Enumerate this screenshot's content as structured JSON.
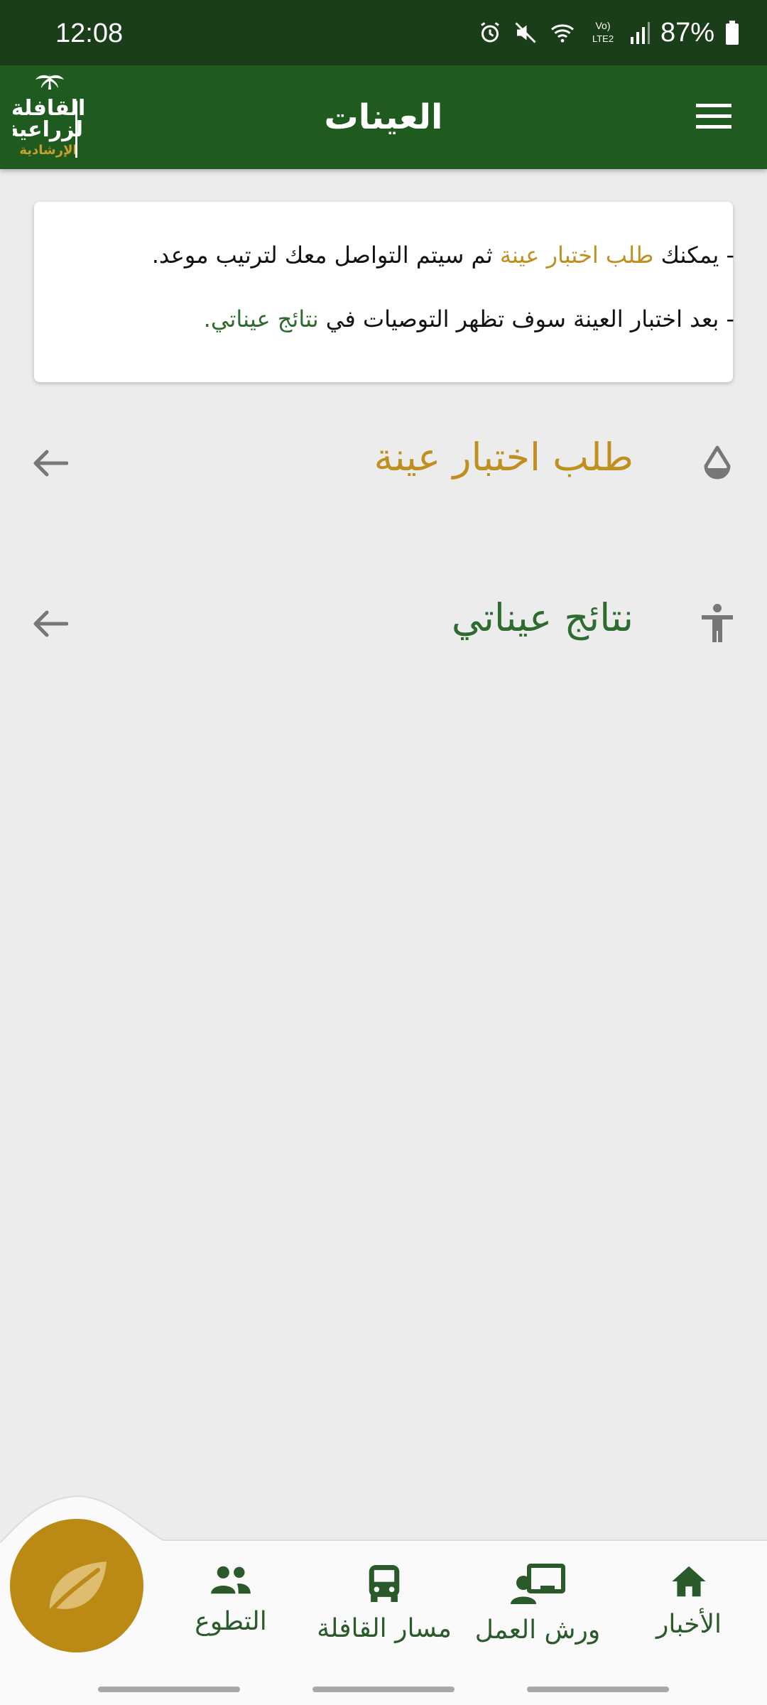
{
  "status_bar": {
    "time": "12:08",
    "battery": "87%",
    "icons": [
      "alarm-icon",
      "mute-icon",
      "wifi-icon",
      "volte-lte2-icon",
      "signal-icon",
      "battery-icon"
    ]
  },
  "app_bar": {
    "title": "العينات",
    "menu_icon": "hamburger-menu-icon",
    "logo_lines": [
      "القافلة",
      "الزراعية",
      "الإرشادية"
    ]
  },
  "info_card": {
    "line1_prefix": "- يمكنك ",
    "line1_link": "طلب اختبار عينة",
    "line1_suffix": " ثم سيتم التواصل معك لترتيب موعد.",
    "line2_prefix": "- بعد اختبار العينة سوف تظهر التوصيات في ",
    "line2_link": "نتائج عيناتي",
    "line2_suffix": "."
  },
  "rows": [
    {
      "label": "طلب اختبار عينة",
      "icon": "drop-icon",
      "arrow": "arrow-left-icon",
      "color": "#bf9020"
    },
    {
      "label": "نتائج عيناتي",
      "icon": "person-icon",
      "arrow": "arrow-left-icon",
      "color": "#2e6b2e"
    }
  ],
  "bottom_nav": {
    "items": [
      {
        "label": "الأخبار",
        "icon": "home-icon"
      },
      {
        "label": "ورش العمل",
        "icon": "presentation-icon"
      },
      {
        "label": "مسار القافلة",
        "icon": "bus-icon"
      },
      {
        "label": "التطوع",
        "icon": "people-icon"
      }
    ],
    "fab_icon": "leaf-icon"
  },
  "colors": {
    "status_bar": "#1a3d1a",
    "app_bar": "#1f5b1f",
    "gold": "#bf9020",
    "green": "#2e6b2e",
    "fab": "#bb8a14",
    "background": "#ececec"
  }
}
